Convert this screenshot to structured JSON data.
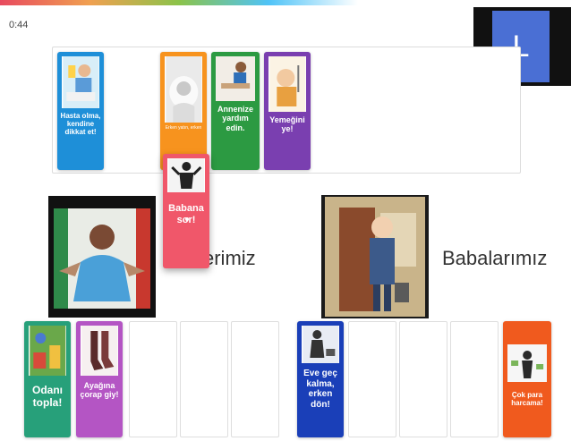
{
  "timer": "0:44",
  "participant": {
    "initial": "L"
  },
  "categories": {
    "left_partial": "erimiz",
    "right": "Babalarımız"
  },
  "top_cards": [
    {
      "text": "Hasta olma, kendine dikkat et!",
      "color": "#1e8fd8"
    },
    {
      "text": "Erken yatın, erken",
      "color": "#f7931e"
    },
    {
      "text": "Annenize yardım edin.",
      "color": "#2c9a42"
    },
    {
      "text": "Yemeğini ye!",
      "color": "#7a3fb0"
    }
  ],
  "dragging_card": {
    "text": "Babana sor!",
    "color": "#f0576a"
  },
  "bottom_cards": [
    {
      "text": "Odanı topla!",
      "color": "#27a07a"
    },
    {
      "text": "Ayağına çorap giy!",
      "color": "#b455c4"
    },
    {
      "text": "Eve geç kalma, erken dön!",
      "color": "#1a3fb8"
    },
    {
      "text": "Çok para harcama!",
      "color": "#f05a1e"
    }
  ]
}
